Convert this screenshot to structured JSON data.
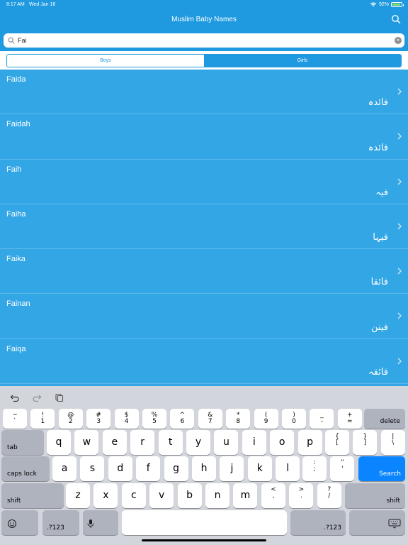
{
  "status": {
    "time": "8:17 AM",
    "date": "Wed Jan 16",
    "battery": "92%",
    "battery_level": 0.92
  },
  "nav": {
    "title": "Muslim Baby Names"
  },
  "search": {
    "value": "Fai"
  },
  "segments": {
    "boys": "Boys",
    "girls": "Girls",
    "selected": "Girls"
  },
  "names": [
    {
      "latin": "Faida",
      "arabic": "فائدہ"
    },
    {
      "latin": "Faidah",
      "arabic": "فائدہ"
    },
    {
      "latin": "Faih",
      "arabic": "فیہ"
    },
    {
      "latin": "Faiha",
      "arabic": "فیہا"
    },
    {
      "latin": "Faika",
      "arabic": "فائقا"
    },
    {
      "latin": "Fainan",
      "arabic": "فینن"
    },
    {
      "latin": "Faiqa",
      "arabic": "فائقہ"
    }
  ],
  "keyboard": {
    "number_row": [
      {
        "top": "~",
        "bot": "`"
      },
      {
        "top": "!",
        "bot": "1"
      },
      {
        "top": "@",
        "bot": "2"
      },
      {
        "top": "#",
        "bot": "3"
      },
      {
        "top": "$",
        "bot": "4"
      },
      {
        "top": "%",
        "bot": "5"
      },
      {
        "top": "^",
        "bot": "6"
      },
      {
        "top": "&",
        "bot": "7"
      },
      {
        "top": "*",
        "bot": "8"
      },
      {
        "top": "(",
        "bot": "9"
      },
      {
        "top": ")",
        "bot": "0"
      },
      {
        "top": "_",
        "bot": "-"
      },
      {
        "top": "+",
        "bot": "="
      }
    ],
    "delete": "delete",
    "tab": "tab",
    "row_q": [
      "q",
      "w",
      "e",
      "r",
      "t",
      "y",
      "u",
      "i",
      "o",
      "p"
    ],
    "row_q_extra": [
      {
        "top": "{",
        "bot": "["
      },
      {
        "top": "}",
        "bot": "]"
      },
      {
        "top": "|",
        "bot": "\\"
      }
    ],
    "caps": "caps lock",
    "row_a": [
      "a",
      "s",
      "d",
      "f",
      "g",
      "h",
      "j",
      "k",
      "l"
    ],
    "row_a_extra": [
      {
        "top": ":",
        "bot": ";"
      },
      {
        "top": "\"",
        "bot": "'"
      }
    ],
    "search": "Search",
    "shift": "shift",
    "row_z": [
      "z",
      "x",
      "c",
      "v",
      "b",
      "n",
      "m"
    ],
    "row_z_extra": [
      {
        "top": "<",
        "bot": ","
      },
      {
        "top": ">",
        "bot": "."
      },
      {
        "top": "?",
        "bot": "/"
      }
    ],
    "numbers": ".?123"
  }
}
